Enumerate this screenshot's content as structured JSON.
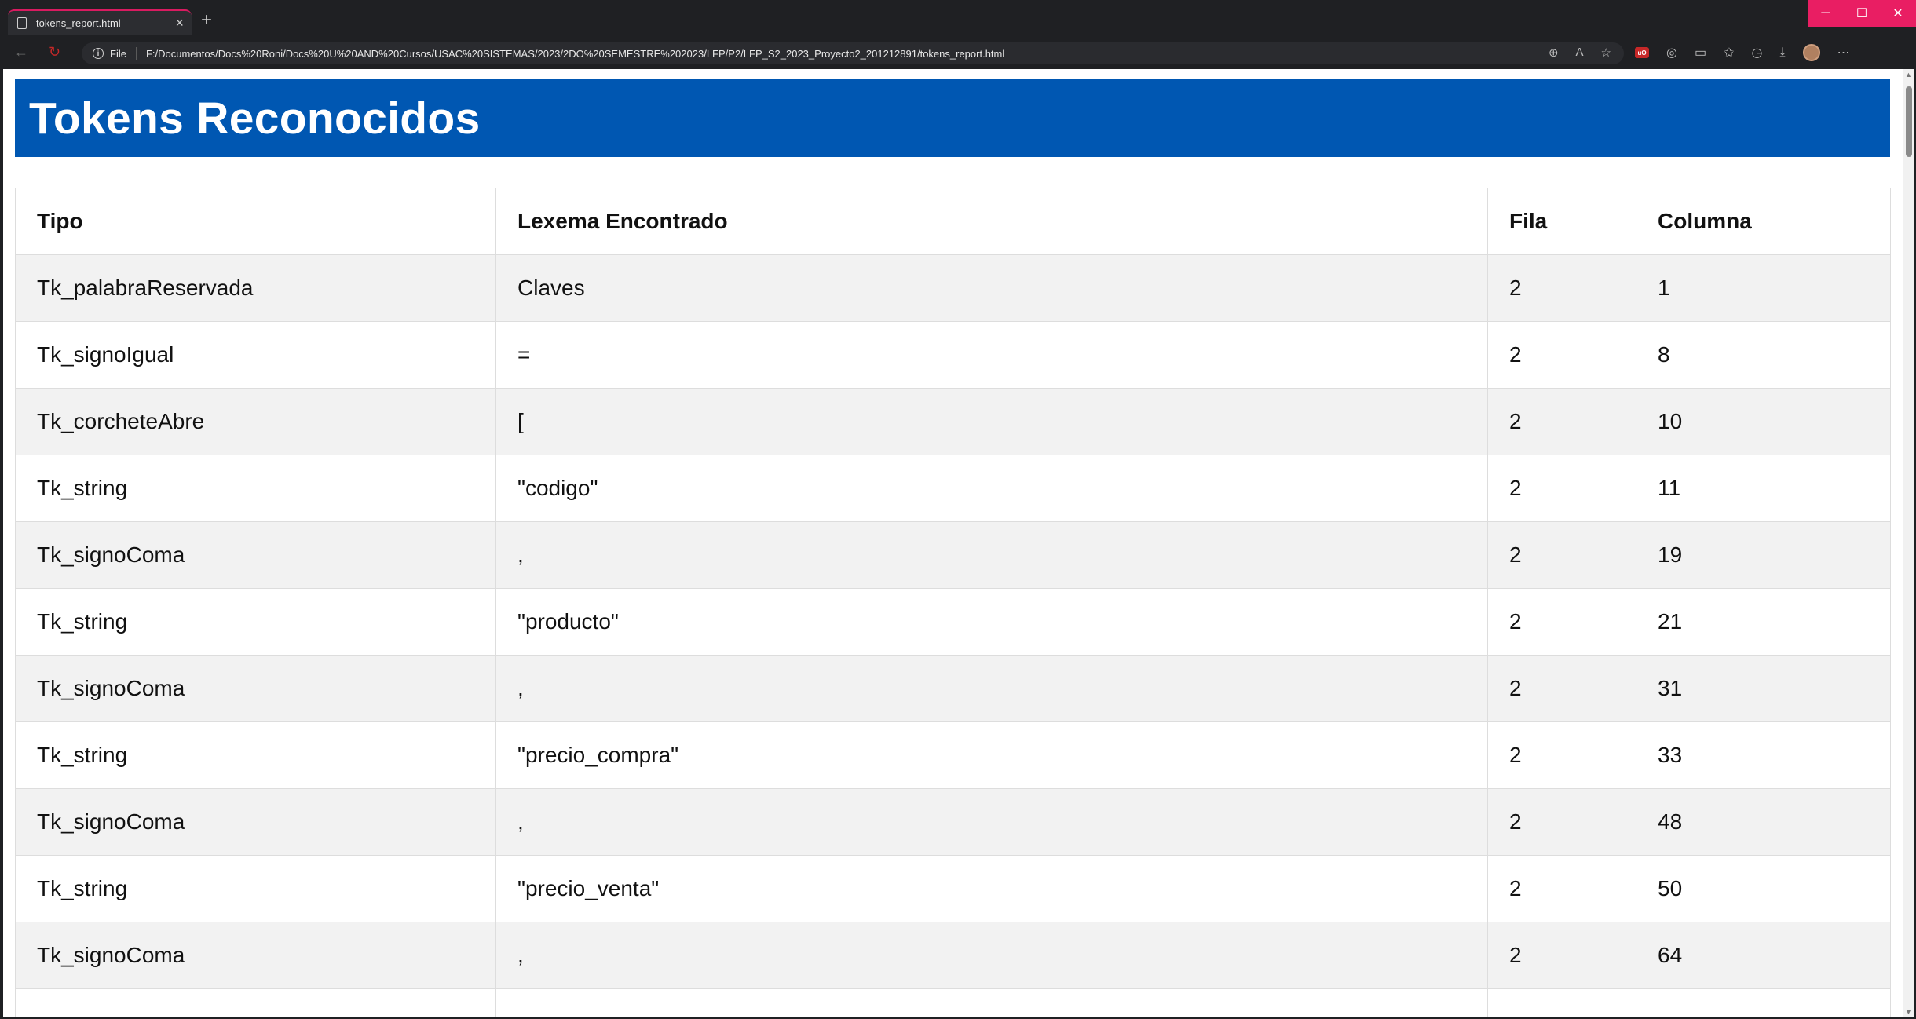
{
  "browser": {
    "tab_title": "tokens_report.html",
    "scheme_label": "File",
    "url": "F:/Documentos/Docs%20Roni/Docs%20U%20AND%20Cursos/USAC%20SISTEMAS/2023/2DO%20SEMESTRE%202023/LFP/P2/LFP_S2_2023_Proyecto2_201212891/tokens_report.html"
  },
  "page": {
    "title": "Tokens Reconocidos"
  },
  "table": {
    "headers": [
      "Tipo",
      "Lexema Encontrado",
      "Fila",
      "Columna"
    ],
    "rows": [
      [
        "Tk_palabraReservada",
        "Claves",
        "2",
        "1"
      ],
      [
        "Tk_signoIgual",
        "=",
        "2",
        "8"
      ],
      [
        "Tk_corcheteAbre",
        "[",
        "2",
        "10"
      ],
      [
        "Tk_string",
        "\"codigo\"",
        "2",
        "11"
      ],
      [
        "Tk_signoComa",
        ",",
        "2",
        "19"
      ],
      [
        "Tk_string",
        "\"producto\"",
        "2",
        "21"
      ],
      [
        "Tk_signoComa",
        ",",
        "2",
        "31"
      ],
      [
        "Tk_string",
        "\"precio_compra\"",
        "2",
        "33"
      ],
      [
        "Tk_signoComa",
        ",",
        "2",
        "48"
      ],
      [
        "Tk_string",
        "\"precio_venta\"",
        "2",
        "50"
      ],
      [
        "Tk_signoComa",
        ",",
        "2",
        "64"
      ],
      [
        "",
        "",
        "",
        ""
      ]
    ]
  },
  "colors": {
    "header_bg": "#0057b2",
    "tab_accent": "#d81b60",
    "window_controls": "#e91e63"
  }
}
